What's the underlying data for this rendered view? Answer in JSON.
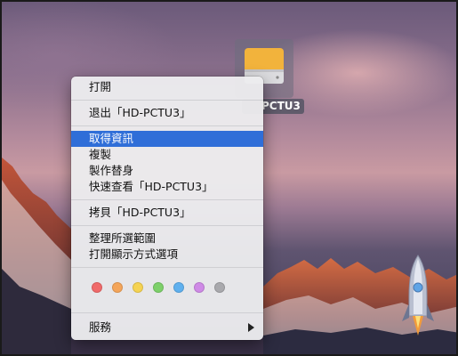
{
  "desktop": {
    "drive_icon": {
      "name": "PCTU3",
      "icon": "external-drive-icon",
      "color": "#f2b33c"
    }
  },
  "context_menu": {
    "items": [
      {
        "label": "打開"
      },
      {
        "label": "退出「HD-PCTU3」"
      },
      {
        "label": "取得資訊",
        "highlighted": true
      },
      {
        "label": "複製"
      },
      {
        "label": "製作替身"
      },
      {
        "label": "快速查看「HD-PCTU3」"
      },
      {
        "label": "拷貝「HD-PCTU3」"
      },
      {
        "label": "整理所選範圍"
      },
      {
        "label": "打開顯示方式選項"
      },
      {
        "label": "服務",
        "submenu": true
      }
    ],
    "tags": [
      {
        "name": "red",
        "color": "#f06a6a"
      },
      {
        "name": "orange",
        "color": "#f4a55a"
      },
      {
        "name": "yellow",
        "color": "#f5d352"
      },
      {
        "name": "green",
        "color": "#7dd06a"
      },
      {
        "name": "blue",
        "color": "#5fb0ee"
      },
      {
        "name": "purple",
        "color": "#cf8ae6"
      },
      {
        "name": "gray",
        "color": "#a9a9ad"
      }
    ],
    "highlight_color": "#2f6ed8"
  }
}
